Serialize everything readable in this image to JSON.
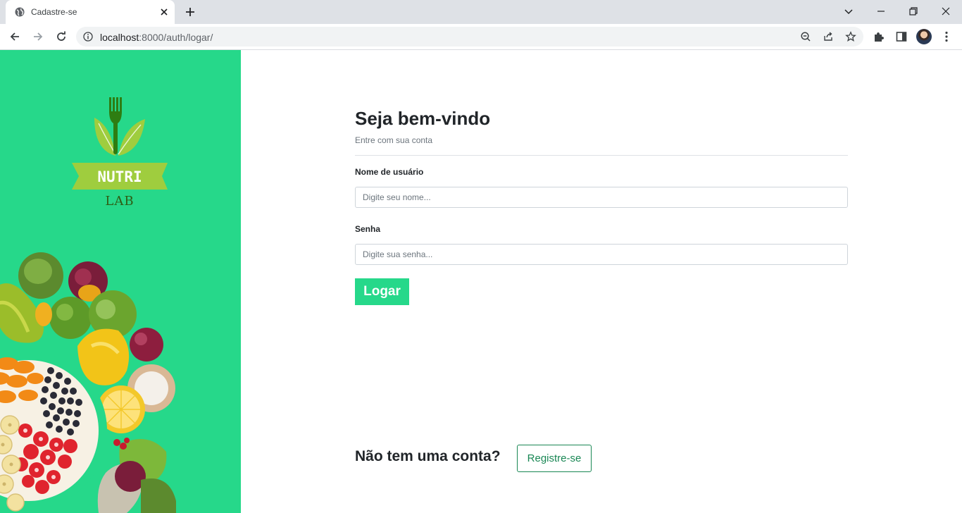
{
  "browser": {
    "tab_title": "Cadastre-se",
    "url_host": "localhost",
    "url_rest": ":8000/auth/logar/"
  },
  "icons": {
    "favicon": "globe-icon",
    "back": "arrow-left-icon",
    "forward": "arrow-right-icon",
    "reload": "reload-icon",
    "info": "info-icon",
    "zoom": "zoom-out-icon",
    "share": "share-icon",
    "bookmark": "star-icon",
    "extensions": "puzzle-icon",
    "sidepanel": "side-panel-icon",
    "menu": "kebab-menu-icon"
  },
  "colors": {
    "brand_green": "#26d88a",
    "outline_green": "#198754"
  },
  "logo": {
    "line1": "NUTRI",
    "line2": "LAB"
  },
  "form": {
    "title": "Seja bem-vindo",
    "subtitle": "Entre com sua conta",
    "username_label": "Nome de usuário",
    "username_placeholder": "Digite seu nome...",
    "password_label": "Senha",
    "password_placeholder": "Digite sua senha...",
    "submit_label": "Logar"
  },
  "register": {
    "prompt": "Não tem uma conta?",
    "button_label": "Registre-se"
  }
}
